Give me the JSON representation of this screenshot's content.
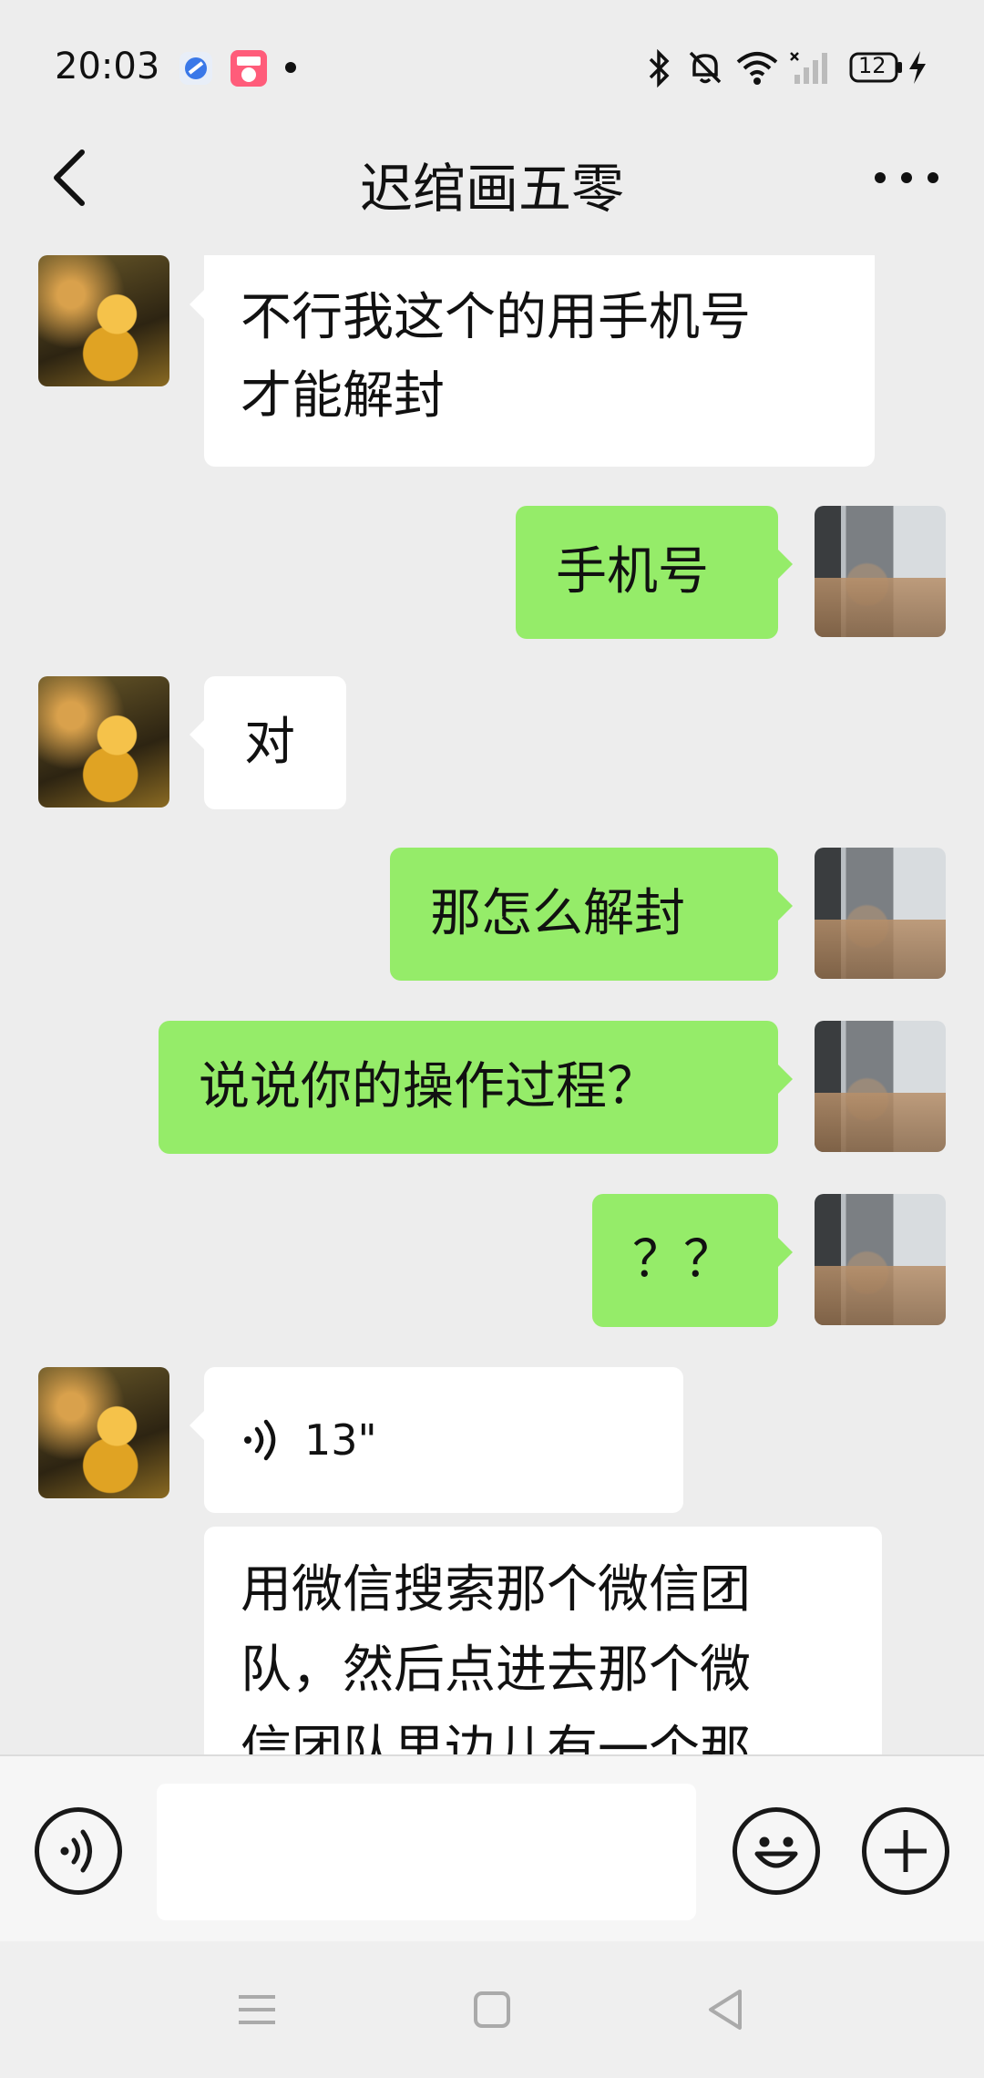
{
  "status_bar": {
    "time": "20:03",
    "battery": "12",
    "icons": [
      "app-blue-icon",
      "app-pink-icon",
      "notification-dot-icon",
      "bluetooth-icon",
      "mute-icon",
      "wifi-icon",
      "signal-icon",
      "battery-icon",
      "charging-icon"
    ]
  },
  "header": {
    "title": "迟绾画五零",
    "back_icon": "chevron-left-icon",
    "more_icon": "more-dots-icon"
  },
  "messages": [
    {
      "side": "left",
      "type": "text",
      "lines": [
        "不行我这个的用手机号",
        "才能解封"
      ]
    },
    {
      "side": "right",
      "type": "text",
      "text": "手机号"
    },
    {
      "side": "left",
      "type": "text",
      "text": "对"
    },
    {
      "side": "right",
      "type": "text",
      "text": "那怎么解封"
    },
    {
      "side": "right",
      "type": "text",
      "text": "说说你的操作过程？"
    },
    {
      "side": "right",
      "type": "text",
      "text": "？？"
    },
    {
      "side": "left",
      "type": "voice",
      "duration": "13\""
    },
    {
      "side": "left",
      "type": "text",
      "lines": [
        "用微信搜索那个微信团",
        "队，然后点进去那个微",
        "信团队里边儿有一个那"
      ]
    }
  ],
  "input_bar": {
    "placeholder": "",
    "voice_icon": "voice-input-icon",
    "emoji_icon": "emoji-icon",
    "add_icon": "plus-icon"
  },
  "nav_bar": {
    "icons": [
      "menu-icon",
      "home-square-icon",
      "back-triangle-icon"
    ]
  },
  "colors": {
    "background": "#ededed",
    "sent_bubble": "#95ec69",
    "received_bubble": "#ffffff",
    "text": "#111111"
  }
}
